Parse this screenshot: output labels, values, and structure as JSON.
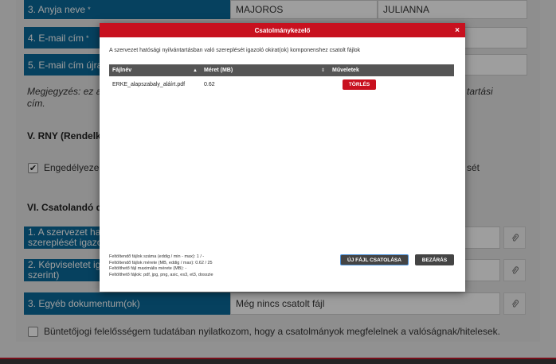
{
  "form": {
    "row_anya_label": "3. Anyja neve",
    "row_anya_req": "*",
    "anya_value1": "MAJOROS",
    "anya_value2": "JULIANNA",
    "row_email_label": "4. E-mail cím",
    "row_email_req": "*",
    "row_email2_label": "5. E-mail cím újra",
    "note_line1": "Megjegyzés: ez a",
    "note_line1_right": "tartási",
    "note_line2": "cím.",
    "section_v": "V. RNY (Rendelk",
    "engedelyez_label": "Engedélyeze",
    "engedelyez_right": "sét",
    "section_vi": "VI. Csatolandó d",
    "doc1_label_line1": "1. A szervezet ha",
    "doc1_label_line2": "szereplését igazo",
    "doc2_label_line1": "2. Képviseletet ig",
    "doc2_label_line2": "szerint)",
    "doc3_label": "3. Egyéb dokumentum(ok)",
    "doc3_value": "Még nincs csatolt fájl",
    "declaration": "Büntetőjogi felelősségem tudatában nyilatkozom, hogy a csatolmányok megfelelnek a valóságnak/hitelesek."
  },
  "modal": {
    "title": "Csatolmánykezelő",
    "close": "×",
    "description": "A szervezet hatósági nyilvántartásban való szereplését igazoló okirat(ok) komponenshez csatolt fájlok",
    "columns": {
      "filename": "Fájlnév",
      "size": "Méret (MB)",
      "actions": "Műveletek"
    },
    "rows": [
      {
        "filename": "ERKE_alapszabaly_aláírt.pdf",
        "size": "0.62",
        "action": "TÖRLÉS"
      }
    ],
    "info": [
      "Feltöltendő fájlok száma (eddig / min - max): 1 / -",
      "Feltöltendő fájlok mérete (MB, eddig / max): 0.62 / 25",
      "Feltölthető fájl maximális mérete (MB): -",
      "Feltölthető fájlok: pdf, jpg, png, asic, es3, et3, dosszie"
    ],
    "btn_new": "ÚJ FÁJL CSATOLÁSA",
    "btn_close": "BEZÁRÁS"
  },
  "colors": {
    "label_bg": "#0b6a99",
    "header_red": "#c8111f",
    "table_head": "#555555"
  }
}
